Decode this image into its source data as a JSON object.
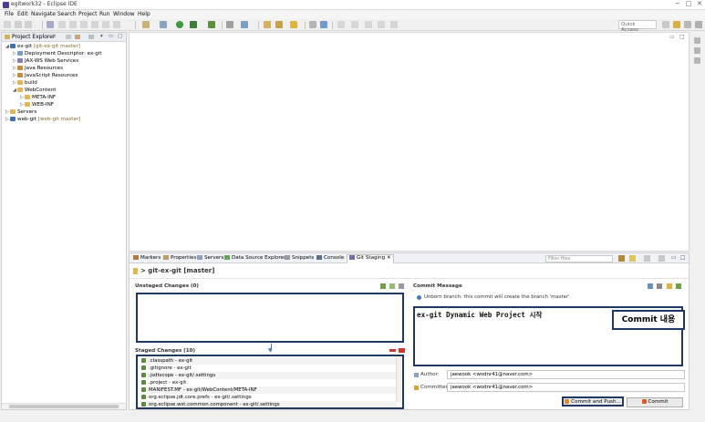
{
  "window": {
    "title": "egitwork32 - Eclipse IDE",
    "controls": [
      "─",
      "□",
      "✕"
    ]
  },
  "menu": [
    "File",
    "Edit",
    "Navigate",
    "Search",
    "Project",
    "Run",
    "Window",
    "Help"
  ],
  "toolbar": {
    "quick_access_placeholder": "Quick Access"
  },
  "explorer": {
    "title": "Project Explorer",
    "close": "✕",
    "items": [
      {
        "label": "ex-git",
        "suffix": "[git-ex-git master]"
      },
      {
        "label": "Deployment Descriptor: ex-git",
        "suffix": ""
      },
      {
        "label": "JAX-WS Web Services",
        "suffix": ""
      },
      {
        "label": "Java Resources",
        "suffix": ""
      },
      {
        "label": "JavaScript Resources",
        "suffix": ""
      },
      {
        "label": "build",
        "suffix": ""
      },
      {
        "label": "WebContent",
        "suffix": ""
      },
      {
        "label": "META-INF",
        "suffix": ""
      },
      {
        "label": "WEB-INF",
        "suffix": ""
      },
      {
        "label": "Servers",
        "suffix": ""
      },
      {
        "label": "web-git",
        "suffix": "[web-git master]"
      }
    ]
  },
  "tabs": [
    {
      "label": "Markers"
    },
    {
      "label": "Properties"
    },
    {
      "label": "Servers"
    },
    {
      "label": "Data Source Explorer"
    },
    {
      "label": "Snippets"
    },
    {
      "label": "Console"
    },
    {
      "label": "Git Staging",
      "close": "✕"
    }
  ],
  "filter_placeholder": "Filter files",
  "staging": {
    "repository": "> git-ex-git [master]",
    "unstaged_title": "Unstaged Changes (0)",
    "staged_title": "Staged Changes (10)",
    "staged_files": [
      ".classpath - ex-git",
      ".gitignore - ex-git",
      ".jsdtscope - ex-git/.settings",
      ".project - ex-git",
      "MANIFEST.MF - ex-git/WebContent/META-INF",
      "org.eclipse.jdt.core.prefs - ex-git/.settings",
      "org.eclipse.wst.common.component - ex-git/.settings"
    ],
    "commit_message_title": "Commit Message",
    "branch_info": "Unborn branch: this commit will create the branch 'master'.",
    "commit_message": "ex-git Dynamic Web Project 시작",
    "annotation": "Commit 내용",
    "author_label": "Author:",
    "author_value": "jaewook <wodnr41@naver.com>",
    "committer_label": "Committer:",
    "committer_value": "jaewook <wodnr41@naver.com>",
    "commit_push_label": "Commit and Push...",
    "commit_label": "Commit"
  },
  "colors": {
    "annotation_border": "#203864",
    "folder": "#e3b652",
    "project": "#3e6fb3"
  }
}
